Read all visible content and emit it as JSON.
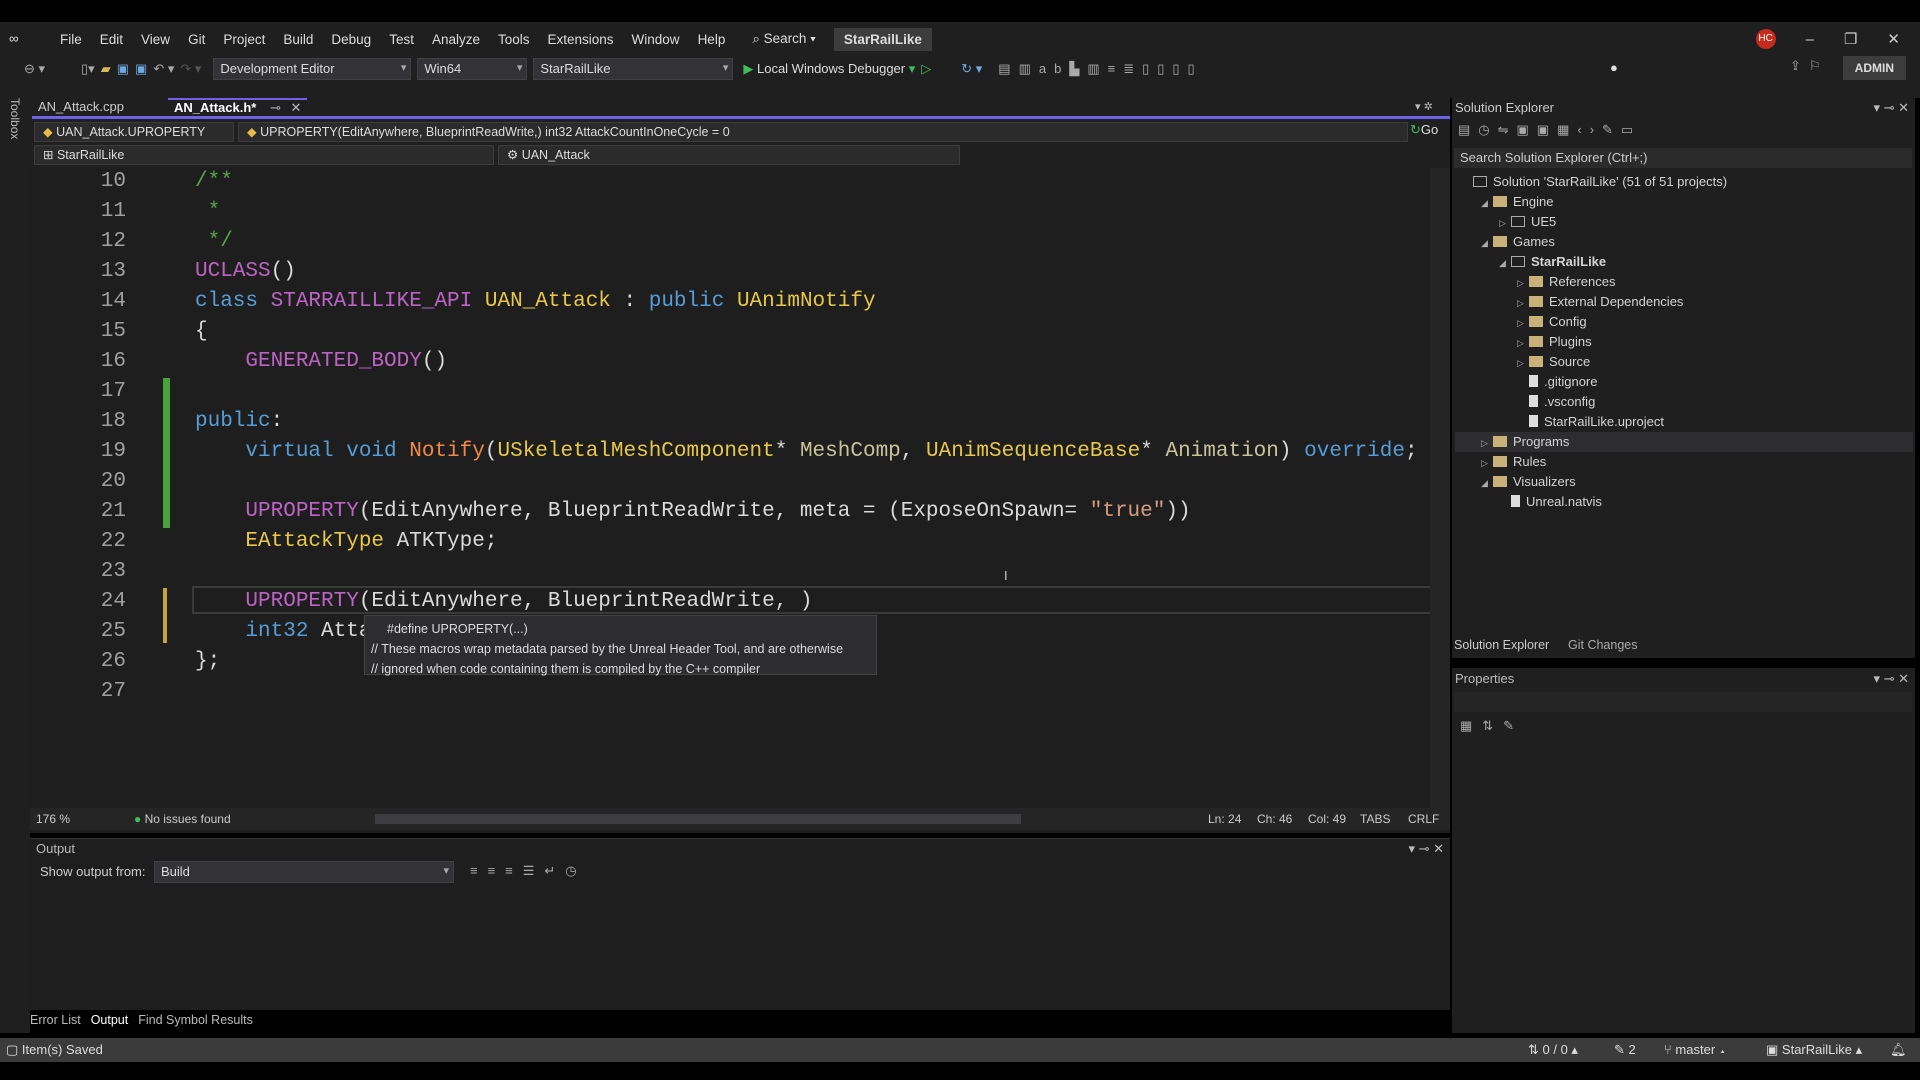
{
  "menu": [
    "File",
    "Edit",
    "View",
    "Git",
    "Project",
    "Build",
    "Debug",
    "Test",
    "Analyze",
    "Tools",
    "Extensions",
    "Window",
    "Help"
  ],
  "search": "Search",
  "solution_title": "StarRailLike",
  "user_initials": "HC",
  "admin": "ADMIN",
  "toolbar": {
    "config": "Development Editor",
    "platform": "Win64",
    "project": "StarRailLike",
    "debugger": "Local Windows Debugger"
  },
  "tabs": [
    {
      "label": "AN_Attack.cpp"
    },
    {
      "label": "AN_Attack.h*"
    }
  ],
  "toolbox": "Toolbox",
  "nav": {
    "scope": "UAN_Attack.UPROPERTY",
    "member": "UPROPERTY(EditAnywhere, BlueprintReadWrite,) int32 AttackCountInOneCycle = 0",
    "go": "Go",
    "project": "StarRailLike",
    "class": "UAN_Attack"
  },
  "code": [
    {
      "n": "10",
      "t": [
        [
          "/**",
          "cm"
        ]
      ]
    },
    {
      "n": "11",
      "t": [
        [
          " *",
          "cm"
        ]
      ]
    },
    {
      "n": "12",
      "t": [
        [
          " */",
          "cm"
        ]
      ]
    },
    {
      "n": "13",
      "t": [
        [
          "UCLASS",
          "mc"
        ],
        [
          "()",
          "tx"
        ]
      ]
    },
    {
      "n": "14",
      "t": [
        [
          "class ",
          "kw"
        ],
        [
          "STARRAILLIKE_API ",
          "mc"
        ],
        [
          "UAN_Attack",
          "ty"
        ],
        [
          " : ",
          "tx"
        ],
        [
          "public ",
          "kw"
        ],
        [
          "UAnimNotify",
          "ty"
        ]
      ]
    },
    {
      "n": "15",
      "t": [
        [
          "{",
          "tx"
        ]
      ]
    },
    {
      "n": "16",
      "t": [
        [
          "    GENERATED_BODY",
          "mc"
        ],
        [
          "()",
          "tx"
        ]
      ]
    },
    {
      "n": "17",
      "t": []
    },
    {
      "n": "18",
      "t": [
        [
          "public",
          "kw"
        ],
        [
          ":",
          "tx"
        ]
      ]
    },
    {
      "n": "19",
      "t": [
        [
          "    virtual void ",
          "kw"
        ],
        [
          "Notify",
          "fn"
        ],
        [
          "(",
          "tx"
        ],
        [
          "USkeletalMeshComponent",
          "ty"
        ],
        [
          "* ",
          "tx"
        ],
        [
          "MeshComp",
          "pm"
        ],
        [
          ", ",
          "tx"
        ],
        [
          "UAnimSequenceBase",
          "ty"
        ],
        [
          "* ",
          "tx"
        ],
        [
          "Animation",
          "pm"
        ],
        [
          ") ",
          "tx"
        ],
        [
          "override",
          "kw"
        ],
        [
          ";",
          "tx"
        ]
      ]
    },
    {
      "n": "20",
      "t": []
    },
    {
      "n": "21",
      "t": [
        [
          "    UPROPERTY",
          "mc"
        ],
        [
          "(EditAnywhere, BlueprintReadWrite, meta = (ExposeOnSpawn= ",
          "tx"
        ],
        [
          "\"true\"",
          "st"
        ],
        [
          "))",
          "tx"
        ]
      ]
    },
    {
      "n": "22",
      "t": [
        [
          "    EAttackType ",
          "ty"
        ],
        [
          "ATKType;",
          "tx"
        ]
      ]
    },
    {
      "n": "23",
      "t": []
    },
    {
      "n": "24",
      "t": [
        [
          "    UPROPERTY",
          "mc"
        ],
        [
          "(EditAnywhere, BlueprintReadWrite, )",
          "tx"
        ]
      ]
    },
    {
      "n": "25",
      "t": [
        [
          "    int32 ",
          "kw"
        ],
        [
          "Atta",
          "tx"
        ]
      ]
    },
    {
      "n": "26",
      "t": [
        [
          "};",
          "tx"
        ]
      ]
    },
    {
      "n": "27",
      "t": []
    }
  ],
  "tooltip": {
    "line1": "#define UPROPERTY(...)",
    "line2": "// These macros wrap metadata parsed by the Unreal Header Tool, and are otherwise",
    "line3": "// ignored when code containing them is compiled by the C++ compiler"
  },
  "editor_status": {
    "zoom": "176 %",
    "issues": "No issues found",
    "ln": "Ln: 24",
    "ch": "Ch: 46",
    "col": "Col: 49",
    "tabs": "TABS",
    "eol": "CRLF"
  },
  "output": {
    "title": "Output",
    "show_from": "Show output from:",
    "source": "Build"
  },
  "bottom_tabs": [
    "Error List",
    "Output",
    "Find Symbol Results"
  ],
  "status": {
    "message": "Item(s) Saved",
    "changes": "0 / 0",
    "edits": "2",
    "branch": "master",
    "repo": "StarRailLike"
  },
  "solution_explorer": {
    "title": "Solution Explorer",
    "search": "Search Solution Explorer (Ctrl+;)",
    "items": [
      {
        "label": "Solution 'StarRailLike' (51 of 51 projects)",
        "depth": 0,
        "arrow": ""
      },
      {
        "label": "Engine",
        "depth": 1,
        "arrow": "◢"
      },
      {
        "label": "UE5",
        "depth": 2,
        "arrow": "▷"
      },
      {
        "label": "Games",
        "depth": 1,
        "arrow": "◢"
      },
      {
        "label": "StarRailLike",
        "depth": 2,
        "arrow": "◢"
      },
      {
        "label": "References",
        "depth": 3,
        "arrow": "▷"
      },
      {
        "label": "External Dependencies",
        "depth": 3,
        "arrow": "▷"
      },
      {
        "label": "Config",
        "depth": 3,
        "arrow": "▷"
      },
      {
        "label": "Plugins",
        "depth": 3,
        "arrow": "▷"
      },
      {
        "label": "Source",
        "depth": 3,
        "arrow": "▷"
      },
      {
        "label": ".gitignore",
        "depth": 3,
        "arrow": ""
      },
      {
        "label": ".vsconfig",
        "depth": 3,
        "arrow": ""
      },
      {
        "label": "StarRailLike.uproject",
        "depth": 3,
        "arrow": ""
      },
      {
        "label": "Programs",
        "depth": 1,
        "arrow": "▷"
      },
      {
        "label": "Rules",
        "depth": 1,
        "arrow": "▷"
      },
      {
        "label": "Visualizers",
        "depth": 1,
        "arrow": "◢"
      },
      {
        "label": "Unreal.natvis",
        "depth": 2,
        "arrow": ""
      }
    ],
    "tabs": [
      "Solution Explorer",
      "Git Changes"
    ]
  },
  "properties": {
    "title": "Properties"
  },
  "colors": {
    "kw": "#569cd6",
    "mc": "#bd63c5",
    "ty": "#e8c84a",
    "fn": "#f0884a",
    "pm": "#c9c39a",
    "st": "#d69d85",
    "cm": "#57a64a",
    "tx": "#dadada",
    "accent": "#7160e8"
  }
}
